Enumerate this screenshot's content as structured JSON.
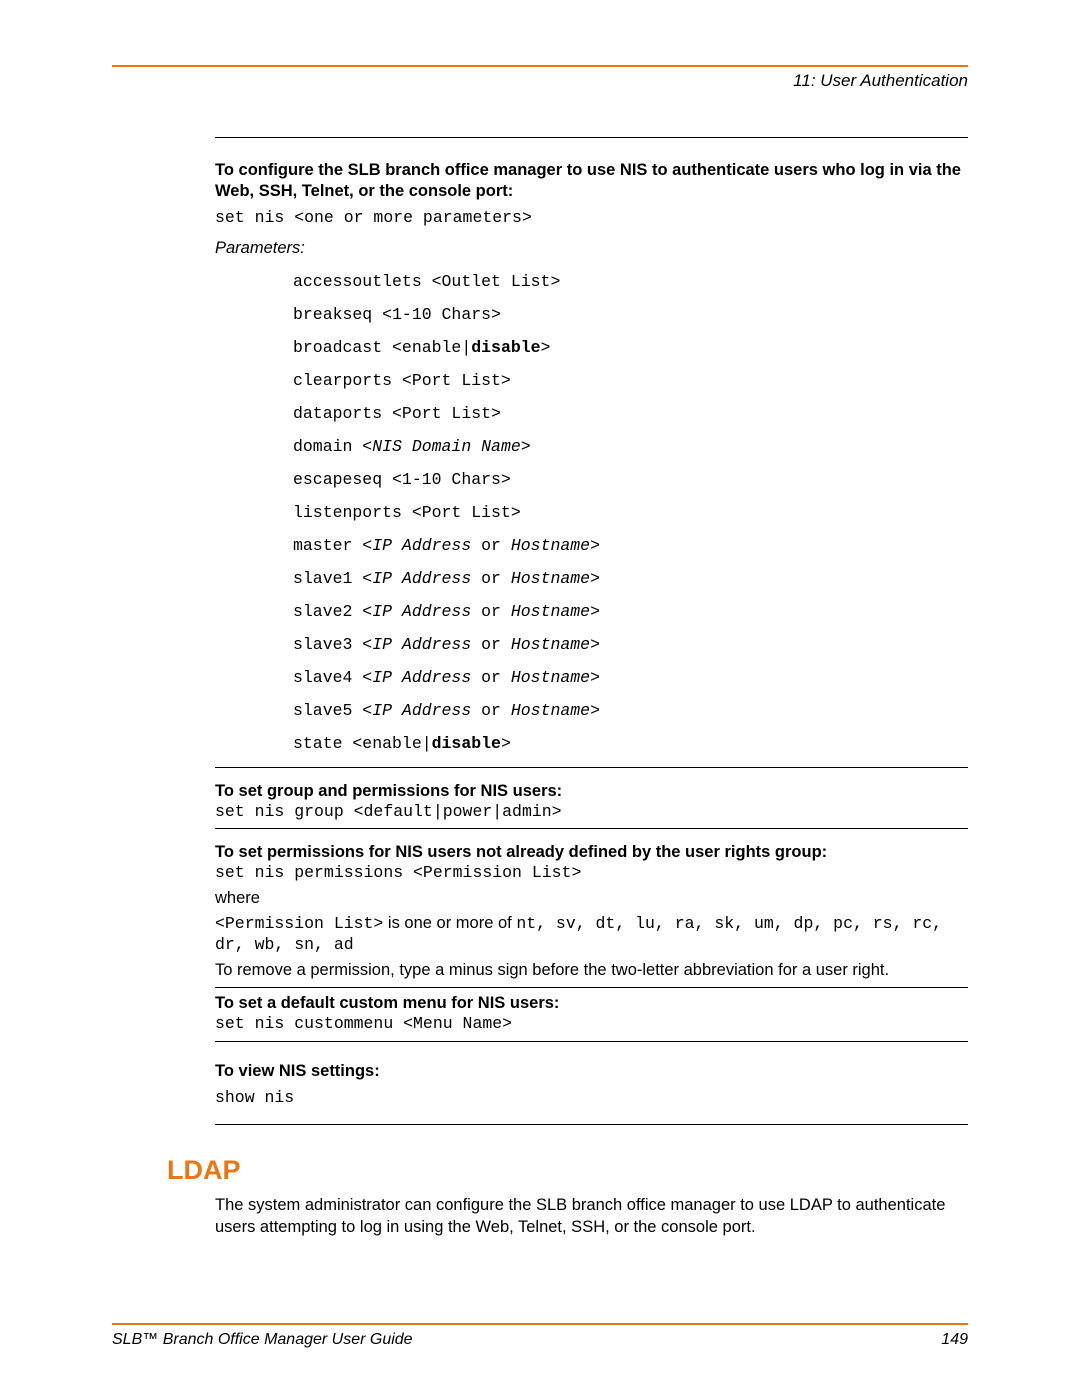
{
  "chapter": "11: User Authentication",
  "intro_title": "To configure the SLB branch office manager to use NIS to authenticate users who log in via the Web, SSH, Telnet, or the console port:",
  "cmd_set_nis": "set nis <one or more parameters>",
  "params_label": "Parameters:",
  "params": {
    "p1": "accessoutlets <Outlet List>",
    "p2": "breakseq <1-10 Chars>",
    "p3_pre": "broadcast <enable|",
    "p3_bold": "disable",
    "p3_post": ">",
    "p4": "clearports <Port List>",
    "p5": "dataports <Port List>",
    "p6_pre": "domain <",
    "p6_i": "NIS Domain Name",
    "p6_post": ">",
    "p7": "escapeseq <1-10 Chars>",
    "p8": "listenports <Port List>",
    "p9_pre": "master <",
    "p9_i": "IP Address",
    "p9_mid": " or ",
    "p9_i2": "Hostname",
    "p9_post": ">",
    "p10_pre": "slave1 <",
    "p10_post": ">",
    "p11_pre": "slave2 <",
    "p11_post": ">",
    "p12_pre": "slave3 <",
    "p12_post": ">",
    "p13_pre": "slave4 <",
    "p13_post": ">",
    "p14_pre": "slave5 <",
    "p14_post": ">",
    "p15_pre": "state <enable|",
    "p15_bold": "disable",
    "p15_post": ">",
    "ip_or_host_ip": "IP Address",
    "ip_or_host_or": " or ",
    "ip_or_host_host": "Hostname"
  },
  "sec_group": {
    "title": "To set group and permissions for NIS users:",
    "cmd": "set nis group <default|power|admin>"
  },
  "sec_perm": {
    "title": "To set permissions for NIS users not already defined by the user rights group:",
    "cmd": "set nis permissions <Permission List>",
    "where": "where",
    "perm_pre": "<Permission List>",
    "perm_mid": " is one or more of ",
    "perm_list": "nt, sv, dt, lu, ra, sk, um, dp, pc, rs, rc, dr, wb, sn, ad",
    "remove_note": "To remove a permission, type a minus sign before the two-letter abbreviation for a user right."
  },
  "sec_menu": {
    "title": "To set a default custom menu for NIS users:",
    "cmd": "set nis custommenu <Menu Name>"
  },
  "sec_view": {
    "title": "To view NIS settings:",
    "cmd": "show nis"
  },
  "ldap": {
    "heading": "LDAP",
    "body": "The system administrator can configure the SLB branch office manager to use LDAP to authenticate users attempting to log in using the Web, Telnet, SSH, or the console port."
  },
  "footer": {
    "guide": "SLB™ Branch Office Manager User Guide",
    "page": "149"
  }
}
